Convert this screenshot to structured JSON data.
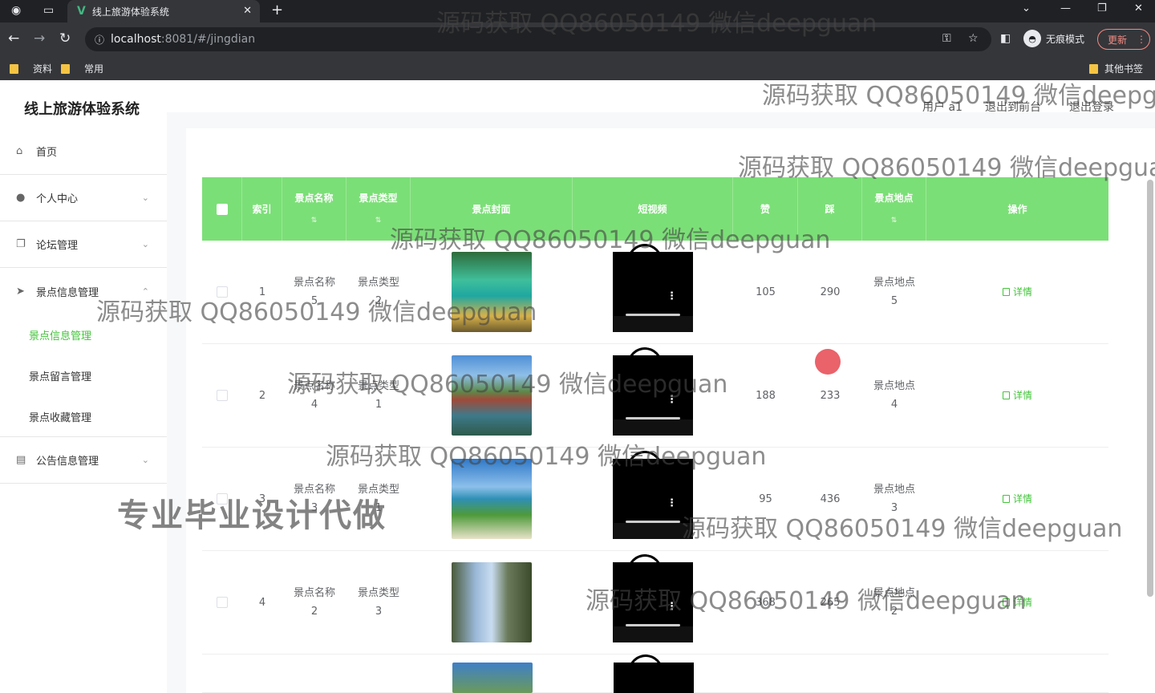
{
  "browser": {
    "tab_title": "线上旅游体验系统",
    "tab_logo": "V",
    "tab_close": "✕",
    "new_tab": "+",
    "url_host": "localhost",
    "url_rest": ":8081/#/jingdian",
    "incognito_label": "无痕模式",
    "update_label": "更新",
    "bookmarks": [
      "资料",
      "常用"
    ],
    "other_bookmarks": "其他书签"
  },
  "header": {
    "brand": "线上旅游体验系统",
    "user_label": "用户 a1",
    "back_to_front": "退出到前台",
    "logout": "退出登录"
  },
  "sidebar": {
    "items": [
      {
        "label": "首页",
        "icon": "home-icon"
      },
      {
        "label": "个人中心",
        "icon": "user-icon"
      },
      {
        "label": "论坛管理",
        "icon": "copy-icon"
      },
      {
        "label": "景点信息管理",
        "icon": "send-icon"
      },
      {
        "label": "公告信息管理",
        "icon": "briefcase-icon"
      }
    ],
    "sub_items": [
      "景点信息管理",
      "景点留言管理",
      "景点收藏管理"
    ]
  },
  "table": {
    "columns": [
      "索引",
      "景点名称",
      "景点类型",
      "景点封面",
      "短视频",
      "赞",
      "踩",
      "景点地点",
      "操作"
    ],
    "rows": [
      {
        "index": "1",
        "name_label": "景点名称",
        "name_val": "5",
        "type_label": "景点类型",
        "type_val": "2",
        "likes": "105",
        "dislikes": "290",
        "loc_label": "景点地点",
        "loc_val": "5",
        "action": "详情"
      },
      {
        "index": "2",
        "name_label": "景点名称",
        "name_val": "4",
        "type_label": "景点类型",
        "type_val": "1",
        "likes": "188",
        "dislikes": "233",
        "loc_label": "景点地点",
        "loc_val": "4",
        "action": "详情"
      },
      {
        "index": "3",
        "name_label": "景点名称",
        "name_val": "3",
        "type_label": "景点类型",
        "type_val": "1",
        "likes": "95",
        "dislikes": "436",
        "loc_label": "景点地点",
        "loc_val": "3",
        "action": "详情"
      },
      {
        "index": "4",
        "name_label": "景点名称",
        "name_val": "2",
        "type_label": "景点类型",
        "type_val": "3",
        "likes": "368",
        "dislikes": "265",
        "loc_label": "景点地点",
        "loc_val": "2",
        "action": "详情"
      }
    ]
  },
  "watermark": "源码获取 QQ86050149 微信deepguan",
  "big_watermark": "专业毕业设计代做",
  "colors": {
    "accent": "#43c43a",
    "header_green": "#7bdf77"
  }
}
